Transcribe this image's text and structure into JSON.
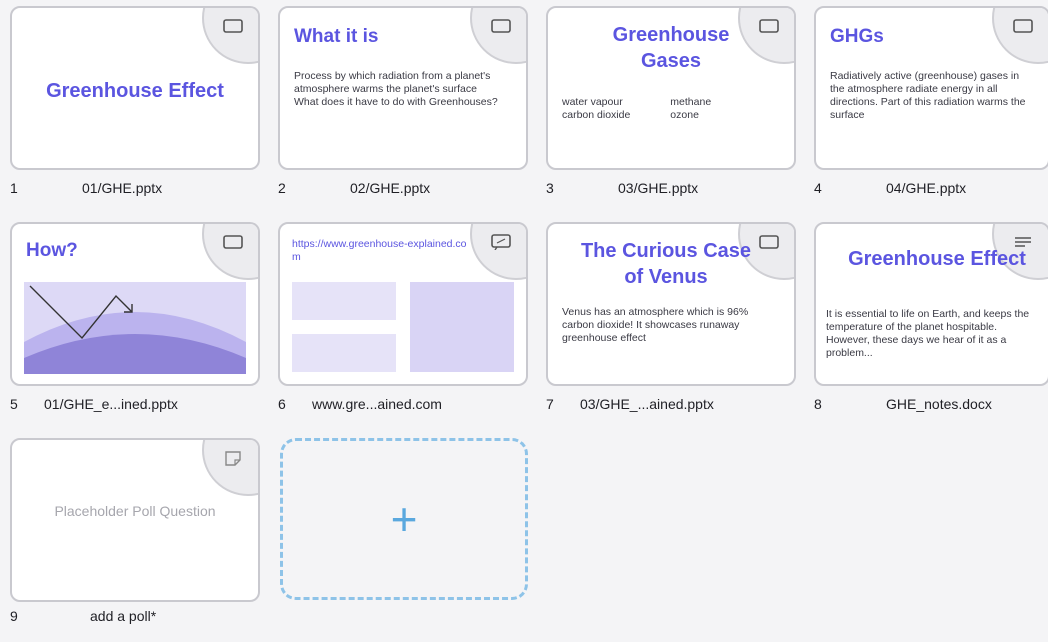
{
  "slides": [
    {
      "num": "1",
      "file": "01/GHE.pptx",
      "title": "Greenhouse Effect",
      "icon": "slide-icon"
    },
    {
      "num": "2",
      "file": "02/GHE.pptx",
      "title": "What it is",
      "body": "Process by which radiation from a planet's atmosphere warms the planet's surface\nWhat does it have to do with Greenhouses?",
      "icon": "slide-icon"
    },
    {
      "num": "3",
      "file": "03/GHE.pptx",
      "title": "Greenhouse Gases",
      "col1": "water vapour\ncarbon dioxide",
      "col2": "methane\nozone",
      "icon": "slide-icon"
    },
    {
      "num": "4",
      "file": "04/GHE.pptx",
      "title": "GHGs",
      "body": "Radiatively active (greenhouse) gases in the atmosphere radiate energy in all directions. Part of this radiation warms the surface",
      "icon": "slide-icon"
    },
    {
      "num": "5",
      "file": "01/GHE_e...ined.pptx",
      "title": "How?",
      "icon": "slide-icon"
    },
    {
      "num": "6",
      "file": "www.gre...ained.com",
      "title": "https://www.greenhouse-explained.com",
      "icon": "web-icon"
    },
    {
      "num": "7",
      "file": "03/GHE_...ained.pptx",
      "title": "The Curious Case of Venus",
      "body": "Venus has an atmosphere which is 96% carbon dioxide! It showcases runaway greenhouse effect",
      "icon": "slide-icon"
    },
    {
      "num": "8",
      "file": "GHE_notes.docx",
      "title": "Greenhouse Effect",
      "body": "It is essential to life on Earth, and keeps the temperature of the planet hospitable. However, these days we hear of it as a problem...",
      "icon": "doc-icon"
    },
    {
      "num": "9",
      "file": "add a poll*",
      "title": "Placeholder Poll Question",
      "icon": "poll-icon"
    }
  ],
  "add_button": {
    "label": "+"
  },
  "colors": {
    "accent": "#5b55e0",
    "add_border": "#8ec3e8",
    "add_plus": "#5aa8de"
  }
}
